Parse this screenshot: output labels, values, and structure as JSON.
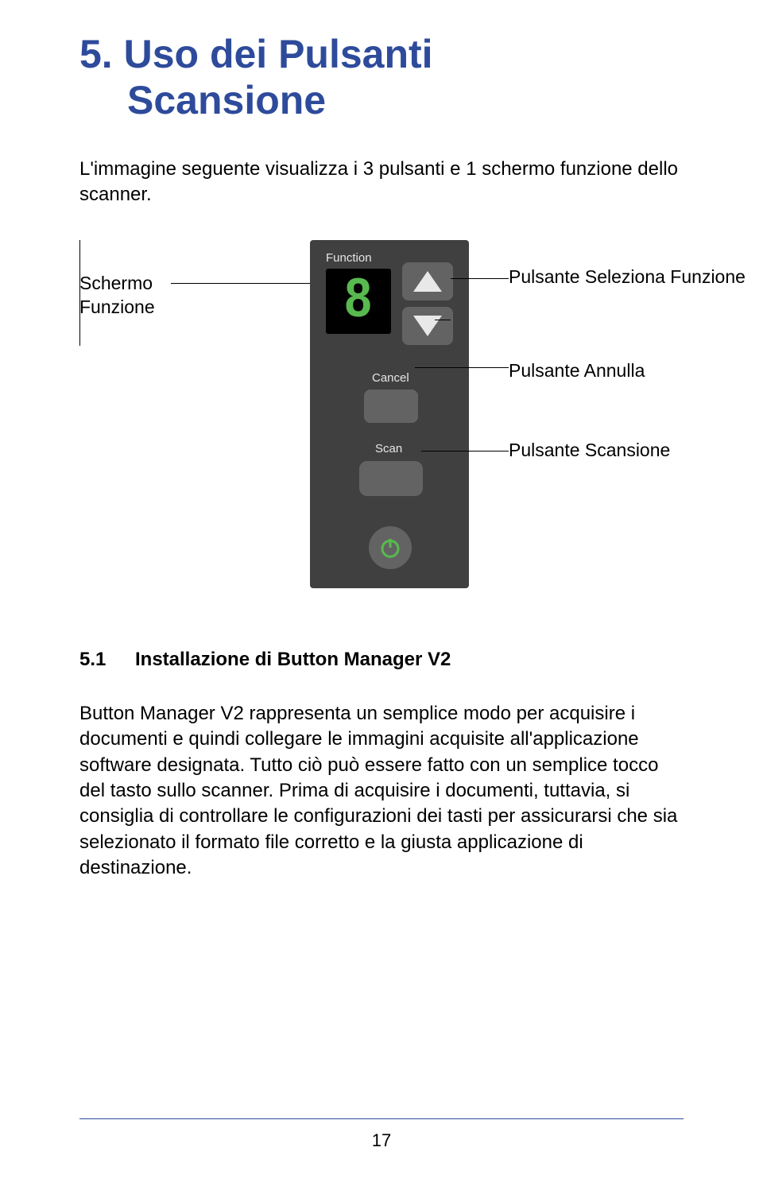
{
  "heading": {
    "line1": "5. Uso dei Pulsanti",
    "line2": "Scansione"
  },
  "intro": "L'immagine seguente visualizza i 3 pulsanti e 1 schermo funzione dello scanner.",
  "diagram": {
    "function_label": "Function",
    "digit": "8",
    "cancel_label": "Cancel",
    "scan_label": "Scan",
    "callouts": {
      "schermo": "Schermo Funzione",
      "seleziona": "Pulsante Seleziona Funzione",
      "annulla": "Pulsante Annulla",
      "scansione": "Pulsante Scansione"
    }
  },
  "section": {
    "number": "5.1",
    "title": "Installazione di Button Manager V2",
    "body": "Button Manager V2 rappresenta un semplice modo per acquisire i documenti e quindi collegare le immagini acquisite all'applicazione software designata. Tutto ciò può essere fatto con un semplice tocco del tasto sullo scanner. Prima di acquisire i documenti, tuttavia, si consiglia di controllare le configurazioni dei tasti per assicurarsi che sia selezionato il formato file corretto e la giusta applicazione di destinazione."
  },
  "page_number": "17"
}
